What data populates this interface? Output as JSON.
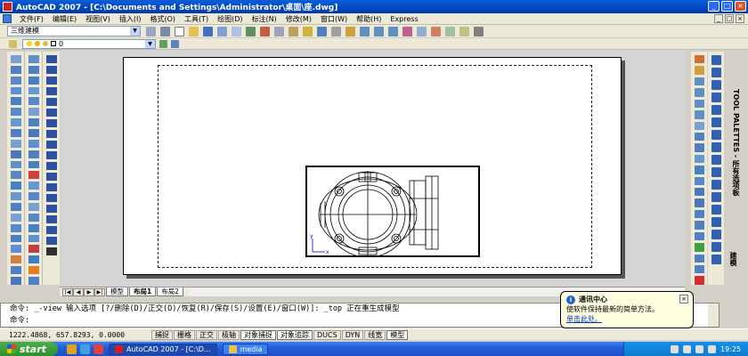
{
  "window": {
    "title": "AutoCAD 2007 - [C:\\Documents and Settings\\Administrator\\桌面\\座.dwg]",
    "controls": [
      "_",
      "□",
      "×"
    ]
  },
  "menu": {
    "items": [
      "文件(F)",
      "编辑(E)",
      "视图(V)",
      "插入(I)",
      "格式(O)",
      "工具(T)",
      "绘图(D)",
      "标注(N)",
      "修改(M)",
      "窗口(W)",
      "帮助(H)",
      "Express"
    ],
    "mdi_controls": [
      "_",
      "□",
      "×"
    ]
  },
  "toolbar": {
    "workspace": "三维建模",
    "layer": "0"
  },
  "layout_tabs": {
    "nav": [
      "|◀",
      "◀",
      "▶",
      "▶|"
    ],
    "tabs": [
      "模型",
      "布局1",
      "布局2"
    ]
  },
  "command": {
    "line1": "命令: _-view 输入选项 [?/删除(D)/正交(O)/恢复(R)/保存(S)/设置(E)/窗口(W)]: _top 正在重生成模型",
    "line2": "命令:"
  },
  "statusbar": {
    "coords": "1222.4868, 657.8293, 0.0000",
    "buttons": [
      "捕捉",
      "栅格",
      "正交",
      "极轴",
      "对象捕捉",
      "对象追踪",
      "DUCS",
      "DYN",
      "线宽",
      "模型"
    ],
    "active": [
      false,
      false,
      false,
      false,
      true,
      true,
      false,
      false,
      false,
      true
    ]
  },
  "balloon": {
    "title": "通讯中心",
    "body": "使软件保持最新的简单方法。",
    "link": "单击此处。"
  },
  "tool_palette": {
    "label": "TOOL PALETTES - 所有选项板",
    "label2": "建模"
  },
  "taskbar": {
    "start": "start",
    "buttons": [
      "AutoCAD 2007 - [C:\\D...",
      "media"
    ],
    "clock": "19:25"
  }
}
